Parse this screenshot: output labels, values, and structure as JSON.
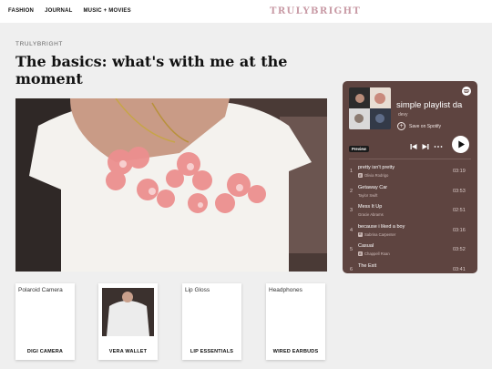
{
  "nav": {
    "items": [
      "FASHION",
      "JOURNAL",
      "MUSIC + MOVIES"
    ]
  },
  "site": {
    "logo": "TRULYBRIGHT"
  },
  "article": {
    "eyebrow": "TRULYBRIGHT",
    "title": "The basics: what's with me at the moment"
  },
  "products": [
    {
      "alt": "Polaroid Camera",
      "name": "DIGI CAMERA"
    },
    {
      "alt": "",
      "name": "VERA WALLET"
    },
    {
      "alt": "Lip Gloss",
      "name": "LIP ESSENTIALS"
    },
    {
      "alt": "Headphones",
      "name": "WIRED EARBUDS"
    }
  ],
  "player": {
    "title": "simple playlist da",
    "owner": "devy",
    "save_label": "Save on Spotify",
    "preview_label": "Preview",
    "tracks": [
      {
        "num": "1",
        "title": "pretty isn't pretty",
        "artist": "Olivia Rodrigo",
        "explicit": true,
        "duration": "03:19"
      },
      {
        "num": "2",
        "title": "Getaway Car",
        "artist": "Taylor Swift",
        "explicit": false,
        "duration": "03:53"
      },
      {
        "num": "3",
        "title": "Mess It Up",
        "artist": "Gracie Abrams",
        "explicit": false,
        "duration": "02:51"
      },
      {
        "num": "4",
        "title": "because i liked a boy",
        "artist": "Sabrina Carpenter",
        "explicit": true,
        "duration": "03:16"
      },
      {
        "num": "5",
        "title": "Casual",
        "artist": "Chappell Roan",
        "explicit": true,
        "duration": "03:52"
      },
      {
        "num": "6",
        "title": "The Exit",
        "artist": "",
        "explicit": false,
        "duration": "03:41"
      }
    ],
    "explicit_badge": "E"
  },
  "colors": {
    "logo": "#c89aa5",
    "player_bg": "#5e4440",
    "page_bg": "#efefef"
  }
}
